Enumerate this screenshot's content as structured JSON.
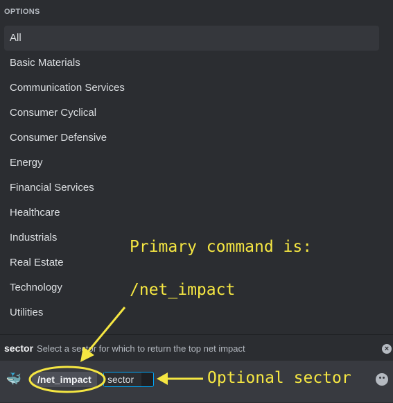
{
  "options_header": "OPTIONS",
  "options": [
    "All",
    "Basic Materials",
    "Communication Services",
    "Consumer Cyclical",
    "Consumer Defensive",
    "Energy",
    "Financial Services",
    "Healthcare",
    "Industrials",
    "Real Estate",
    "Technology",
    "Utilities"
  ],
  "command_bar": {
    "option_name": "sector",
    "option_description": "Select a sector for which to return the top net impact",
    "command": "/net_impact",
    "sector_label": "sector"
  },
  "annotations": {
    "primary_line1": "Primary command is:",
    "primary_line2": "/net_impact",
    "optional": "Optional sector",
    "color": "#f5e642"
  }
}
